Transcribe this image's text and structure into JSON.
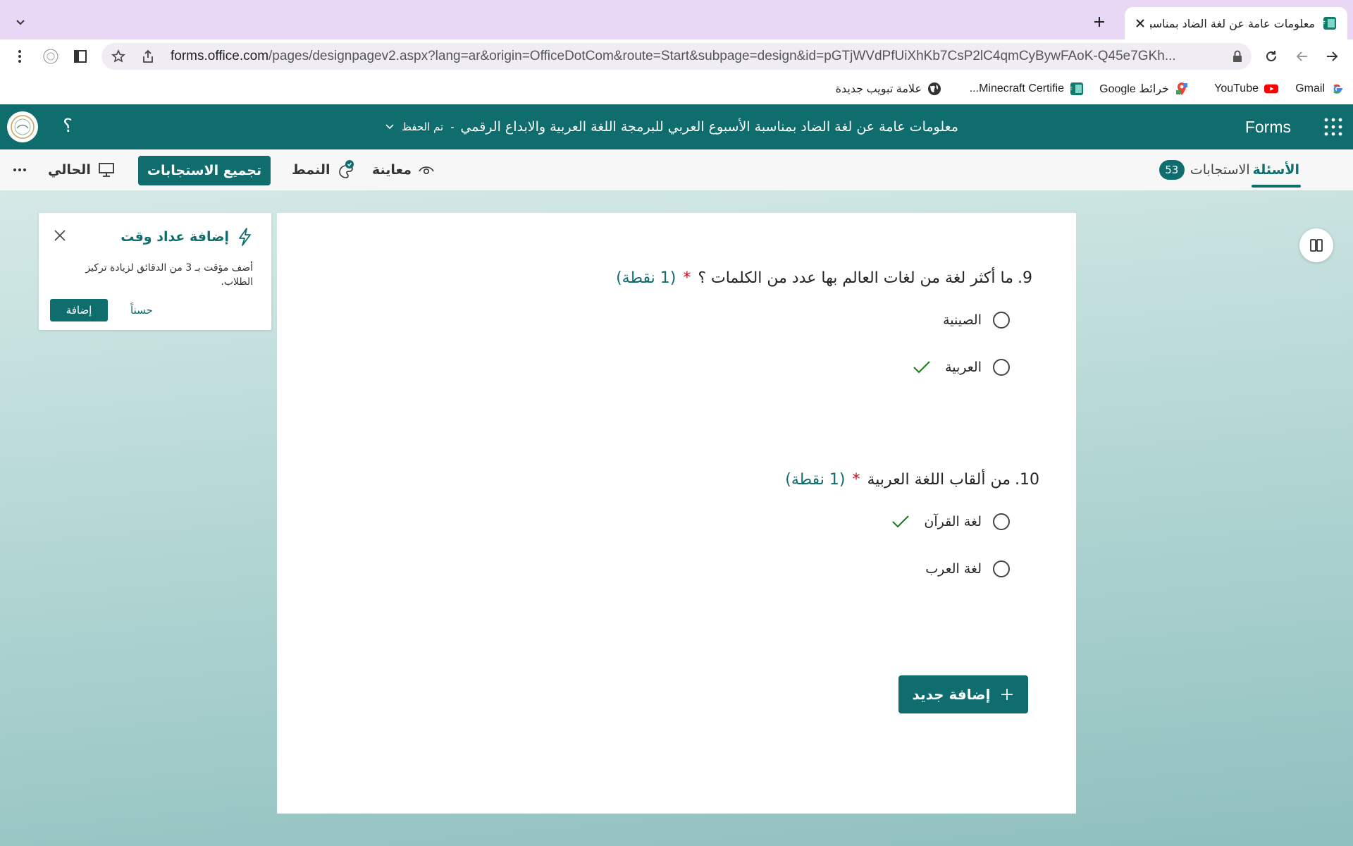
{
  "browser": {
    "tab_title": "معلومات عامة عن لغة الضاد  بمناسبة الأسبوع العربي",
    "url_host": "forms.office.com",
    "url_path": "/pages/designpagev2.aspx?lang=ar&origin=OfficeDotCom&route=Start&subpage=design&id=pGTjWVdPfUiXhKb7CsP2lC4qmCyBywFAoK-Q45e7GKh...",
    "bookmarks": [
      {
        "label": "Gmail",
        "icon": "google-icon"
      },
      {
        "label": "YouTube",
        "icon": "youtube-icon"
      },
      {
        "label": "خرائط Google",
        "icon": "maps-icon"
      },
      {
        "label": "Minecraft Certifie...",
        "icon": "forms-icon"
      },
      {
        "label": "علامة تبويب جديدة",
        "icon": "globe-icon"
      }
    ]
  },
  "appbar": {
    "brand": "Forms",
    "title": "معلومات عامة عن لغة الضاد  بمناسبة الأسبوع العربي للبرمجة اللغة العربية والابداع الرقمي",
    "separator": "-",
    "save_state": "تم الحفظ",
    "help": "؟"
  },
  "commandbar": {
    "tab_questions": "الأسئلة",
    "tab_responses": "الاستجابات",
    "responses_count": "53",
    "preview": "معاينة",
    "style": "النمط",
    "collect": "تجميع الاستجابات",
    "present": "الحالي"
  },
  "timer_card": {
    "title": "إضافة عداد وقت",
    "description": "أضف مؤقت بـ 3 من الدقائق لزيادة تركيز الطلاب.",
    "add_label": "إضافة",
    "ok_label": "حسناً"
  },
  "questions": [
    {
      "number": "9.",
      "text": "ما أكثر لغة من لغات العالم بها عدد من الكلمات ؟",
      "required_mark": "*",
      "points": "(1 نقطة)",
      "options": [
        {
          "label": "الصينية",
          "correct": false
        },
        {
          "label": "العربية",
          "correct": true
        }
      ]
    },
    {
      "number": "10.",
      "text": "من ألقاب اللغة العربية",
      "required_mark": "*",
      "points": "(1 نقطة)",
      "options": [
        {
          "label": "لغة القرآن",
          "correct": true
        },
        {
          "label": "لغة العرب",
          "correct": false
        }
      ]
    }
  ],
  "add_new": "إضافة جديد",
  "colors": {
    "accent": "#0f6d6d",
    "required": "#c50f1f",
    "check": "#107c10",
    "tabstrip": "#e8d7f5"
  }
}
